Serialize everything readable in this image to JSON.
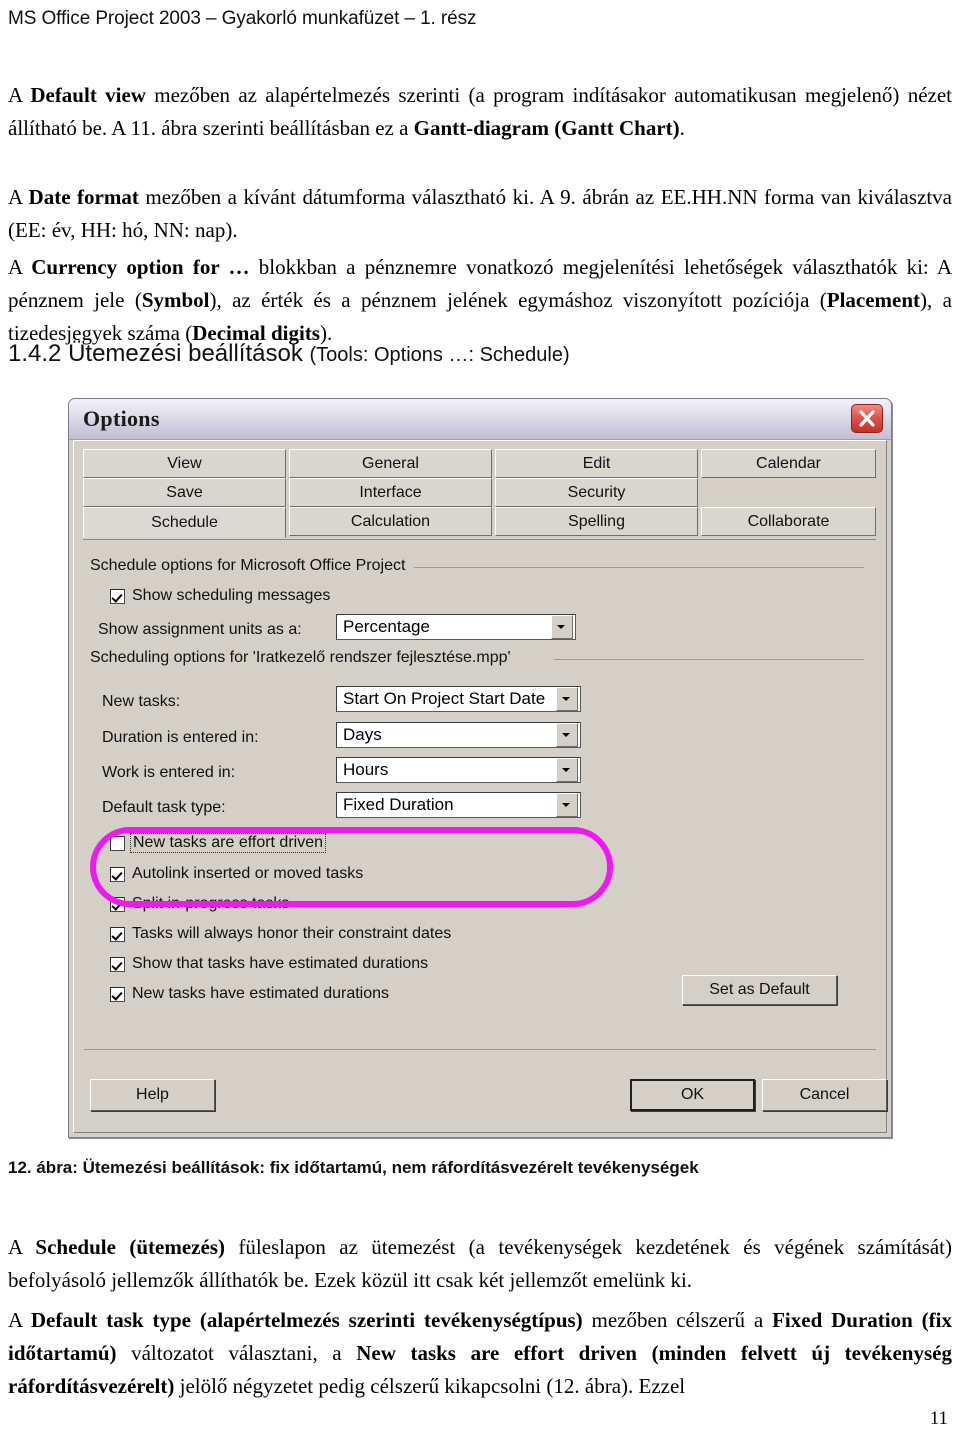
{
  "header": {
    "running_head": "MS Office Project 2003 – Gyakorló munkafüzet – 1. rész"
  },
  "body_text": {
    "para_default_view_pre": "A ",
    "para_default_view_b1": "Default view",
    "para_default_view_mid": " mezőben az alapértelmezés szerinti (a program indításakor automatikusan megjelenő) nézet állítható be. A 11. ábra szerinti beállításban ez a ",
    "para_default_view_b2": "Gantt-diagram (Gantt Chart)",
    "para_default_view_end": ".",
    "para_date_format_pre": "A ",
    "para_date_format_b1": "Date format",
    "para_date_format_end": " mezőben a kívánt dátumforma választható ki. A 9. ábrán az EE.HH.NN forma van kiválasztva (EE: év, HH: hó, NN: nap).",
    "para_currency_pre": "A ",
    "para_currency_b1": "Currency option for …",
    "para_currency_mid1": " blokkban a pénznemre vonatkozó megjelenítési lehetőségek választhatók ki: A pénznem jele (",
    "para_currency_b2": "Symbol",
    "para_currency_mid2": "), az érték és a pénznem jelének egymáshoz viszonyított pozíciója (",
    "para_currency_b3": "Placement",
    "para_currency_mid3": "), a tizedesjegyek száma (",
    "para_currency_b4": "Decimal digits",
    "para_currency_end": ")."
  },
  "section_heading": {
    "number": "1.4.2",
    "title": "Ütemezési beállítások",
    "paren": "(Tools: Options …: Schedule)"
  },
  "dialog": {
    "title": "Options",
    "close_icon": "close-icon",
    "tabs": [
      {
        "label": "View",
        "row": 0,
        "col": 0,
        "active": false
      },
      {
        "label": "General",
        "row": 0,
        "col": 1,
        "active": false
      },
      {
        "label": "Edit",
        "row": 0,
        "col": 2,
        "active": false
      },
      {
        "label": "Calendar",
        "row": 0,
        "col": 3,
        "active": false
      },
      {
        "label": "Save",
        "row": 1,
        "col": 0,
        "active": false
      },
      {
        "label": "Interface",
        "row": 1,
        "col": 1,
        "active": false
      },
      {
        "label": "Security",
        "row": 1,
        "col": 2,
        "active": false
      },
      {
        "label": "Schedule",
        "row": 2,
        "col": 0,
        "active": true
      },
      {
        "label": "Calculation",
        "row": 2,
        "col": 1,
        "active": false
      },
      {
        "label": "Spelling",
        "row": 2,
        "col": 2,
        "active": false
      },
      {
        "label": "Collaborate",
        "row": 2,
        "col": 3,
        "active": false
      }
    ],
    "group1_label": "Schedule options for Microsoft Office Project",
    "group2_label": "Scheduling options for 'Iratkezelő rendszer fejlesztése.mpp'",
    "check_show_scheduling_messages": {
      "label": "Show scheduling messages",
      "checked": true
    },
    "field_show_assignment_units": {
      "label": "Show assignment units as a:",
      "value": "Percentage"
    },
    "field_new_tasks": {
      "label": "New tasks:",
      "value": "Start On Project Start Date"
    },
    "field_duration_entered": {
      "label": "Duration is entered in:",
      "value": "Days"
    },
    "field_work_entered": {
      "label": "Work is entered in:",
      "value": "Hours"
    },
    "field_default_task_type": {
      "label": "Default task type:",
      "value": "Fixed Duration"
    },
    "check_effort_driven": {
      "label": "New tasks are effort driven",
      "checked": false
    },
    "checks": [
      {
        "label": "Autolink inserted or moved tasks",
        "checked": true
      },
      {
        "label": "Split in-progress tasks",
        "checked": true
      },
      {
        "label": "Tasks will always honor their constraint dates",
        "checked": true
      },
      {
        "label": "Show that tasks have estimated durations",
        "checked": true
      },
      {
        "label": "New tasks have estimated durations",
        "checked": true
      }
    ],
    "btn_set_as_default": "Set as Default",
    "btn_help": "Help",
    "btn_ok": "OK",
    "btn_cancel": "Cancel",
    "highlight_color": "#ee19ee"
  },
  "figure": {
    "caption": "12. ábra: Ütemezési beállítások: fix időtartamú, nem ráfordításvezérelt tevékenységek"
  },
  "footer_text": {
    "para_schedule_pre": "A ",
    "para_schedule_b1": "Schedule (ütemezés)",
    "para_schedule_end": " füleslapon az ütemezést (a tevékenységek kezdetének és végének számítását) befolyásoló jellemzők állíthatók be. Ezek közül itt csak két jellemzőt emelünk ki.",
    "para_default_task_pre": "A ",
    "para_default_task_b1": "Default task type (alapértelmezés szerinti tevékenységtípus)",
    "para_default_task_mid1": " mezőben célszerű a ",
    "para_default_task_b2": "Fixed Duration (fix időtartamú)",
    "para_default_task_mid2": " változatot választani, a ",
    "para_default_task_b3": "New tasks are effort driven (minden felvett új tevékenység ráfordításvezérelt)",
    "para_default_task_end": " jelölő négyzetet pedig célszerű kikapcsolni (12. ábra). Ezzel"
  },
  "page_number": "11"
}
